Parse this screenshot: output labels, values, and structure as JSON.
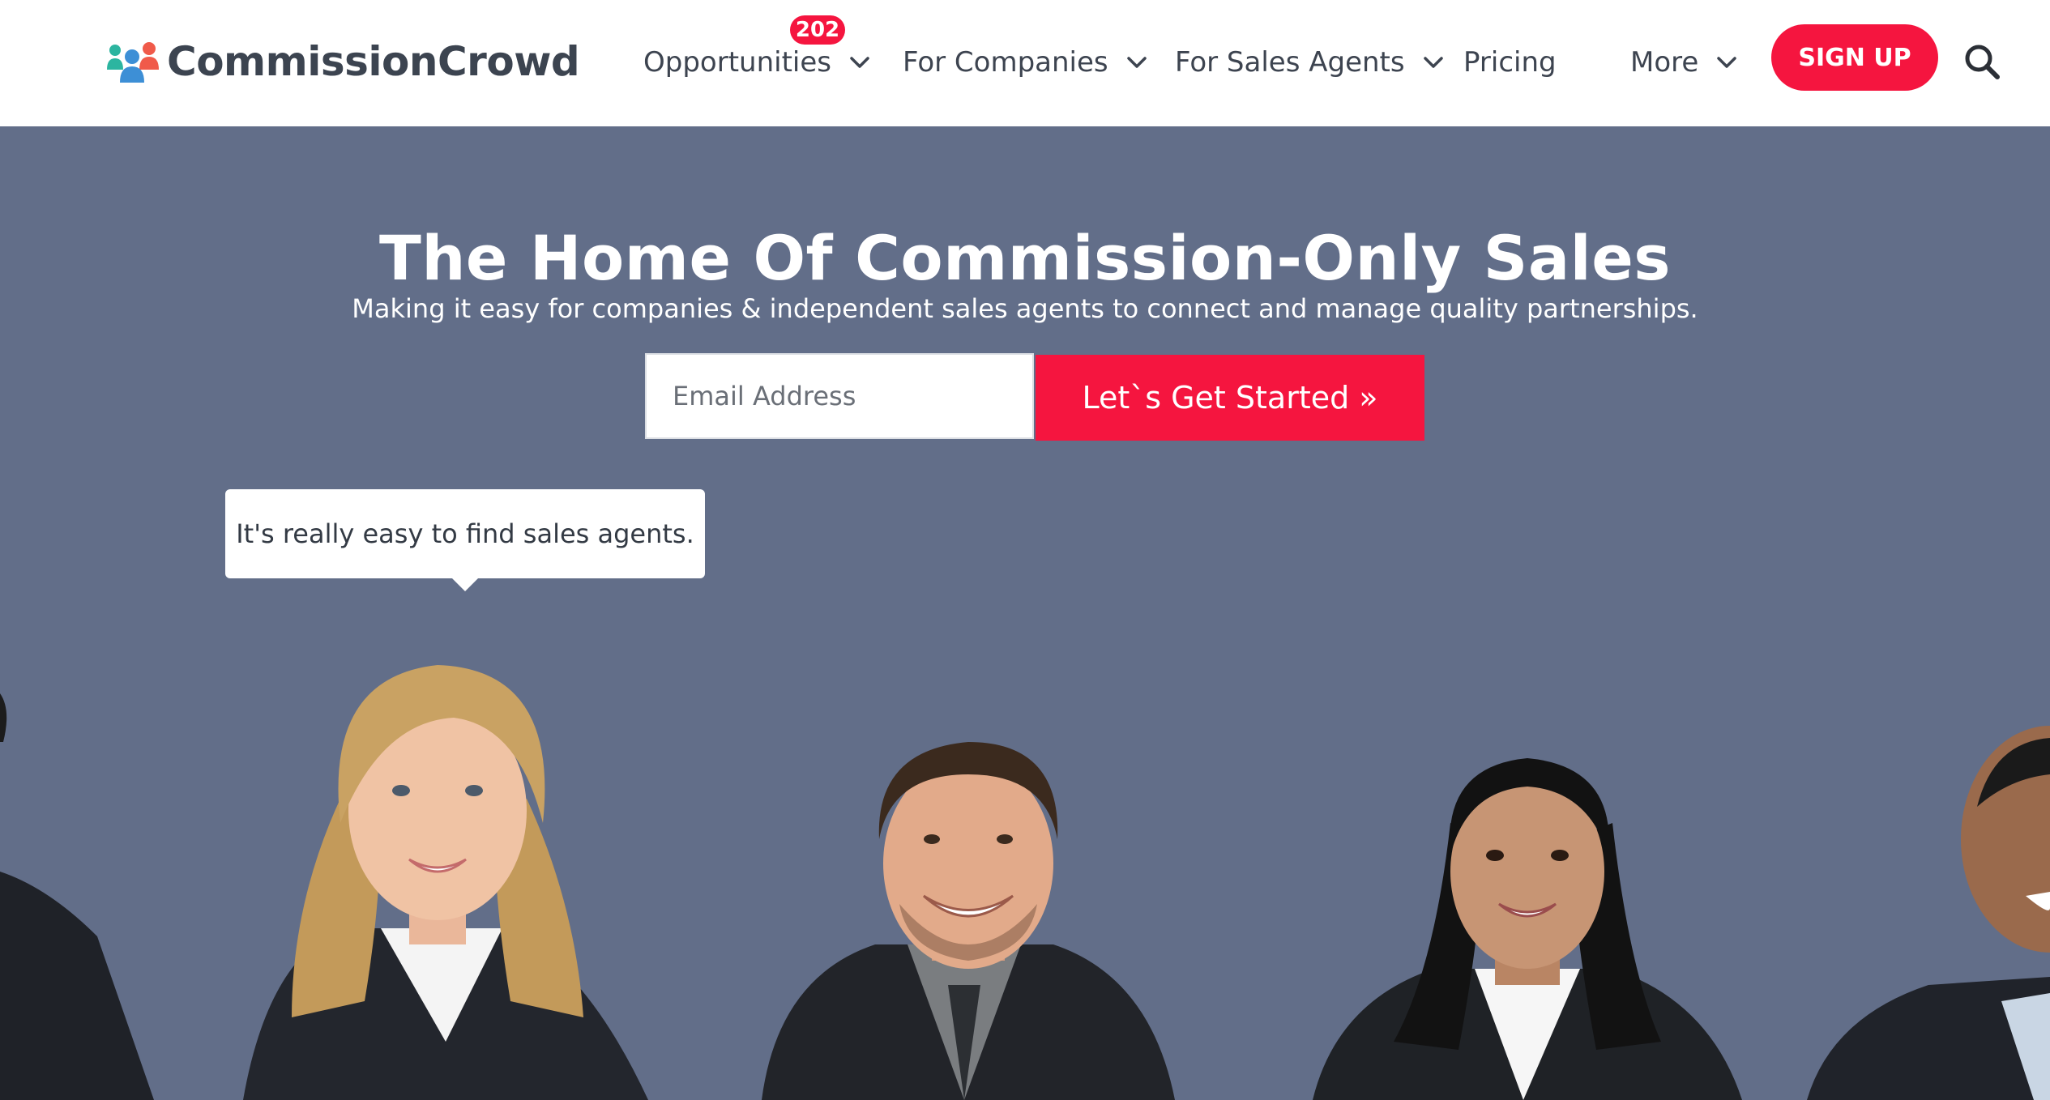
{
  "brand": {
    "name": "CommissionCrowd",
    "colors": {
      "accent": "#f5153f",
      "hero_bg": "#626e89",
      "text": "#3d4450"
    }
  },
  "nav": {
    "opportunities": {
      "label": "Opportunities",
      "badge": "202",
      "icon": "chevron-down-icon"
    },
    "companies": {
      "label": "For Companies",
      "icon": "chevron-down-icon"
    },
    "agents": {
      "label": "For Sales Agents",
      "icon": "chevron-down-icon"
    },
    "pricing": {
      "label": "Pricing"
    },
    "more": {
      "label": "More",
      "icon": "chevron-down-icon"
    },
    "signup_label": "SIGN UP",
    "search_icon": "search-icon"
  },
  "hero": {
    "title": "The Home Of Commission-Only Sales",
    "subtitle": "Making it easy for companies & independent sales agents to connect and manage quality partnerships.",
    "email_placeholder": "Email Address",
    "cta_label": "Let`s Get Started »",
    "tooltip": "It's really easy to find sales agents."
  }
}
